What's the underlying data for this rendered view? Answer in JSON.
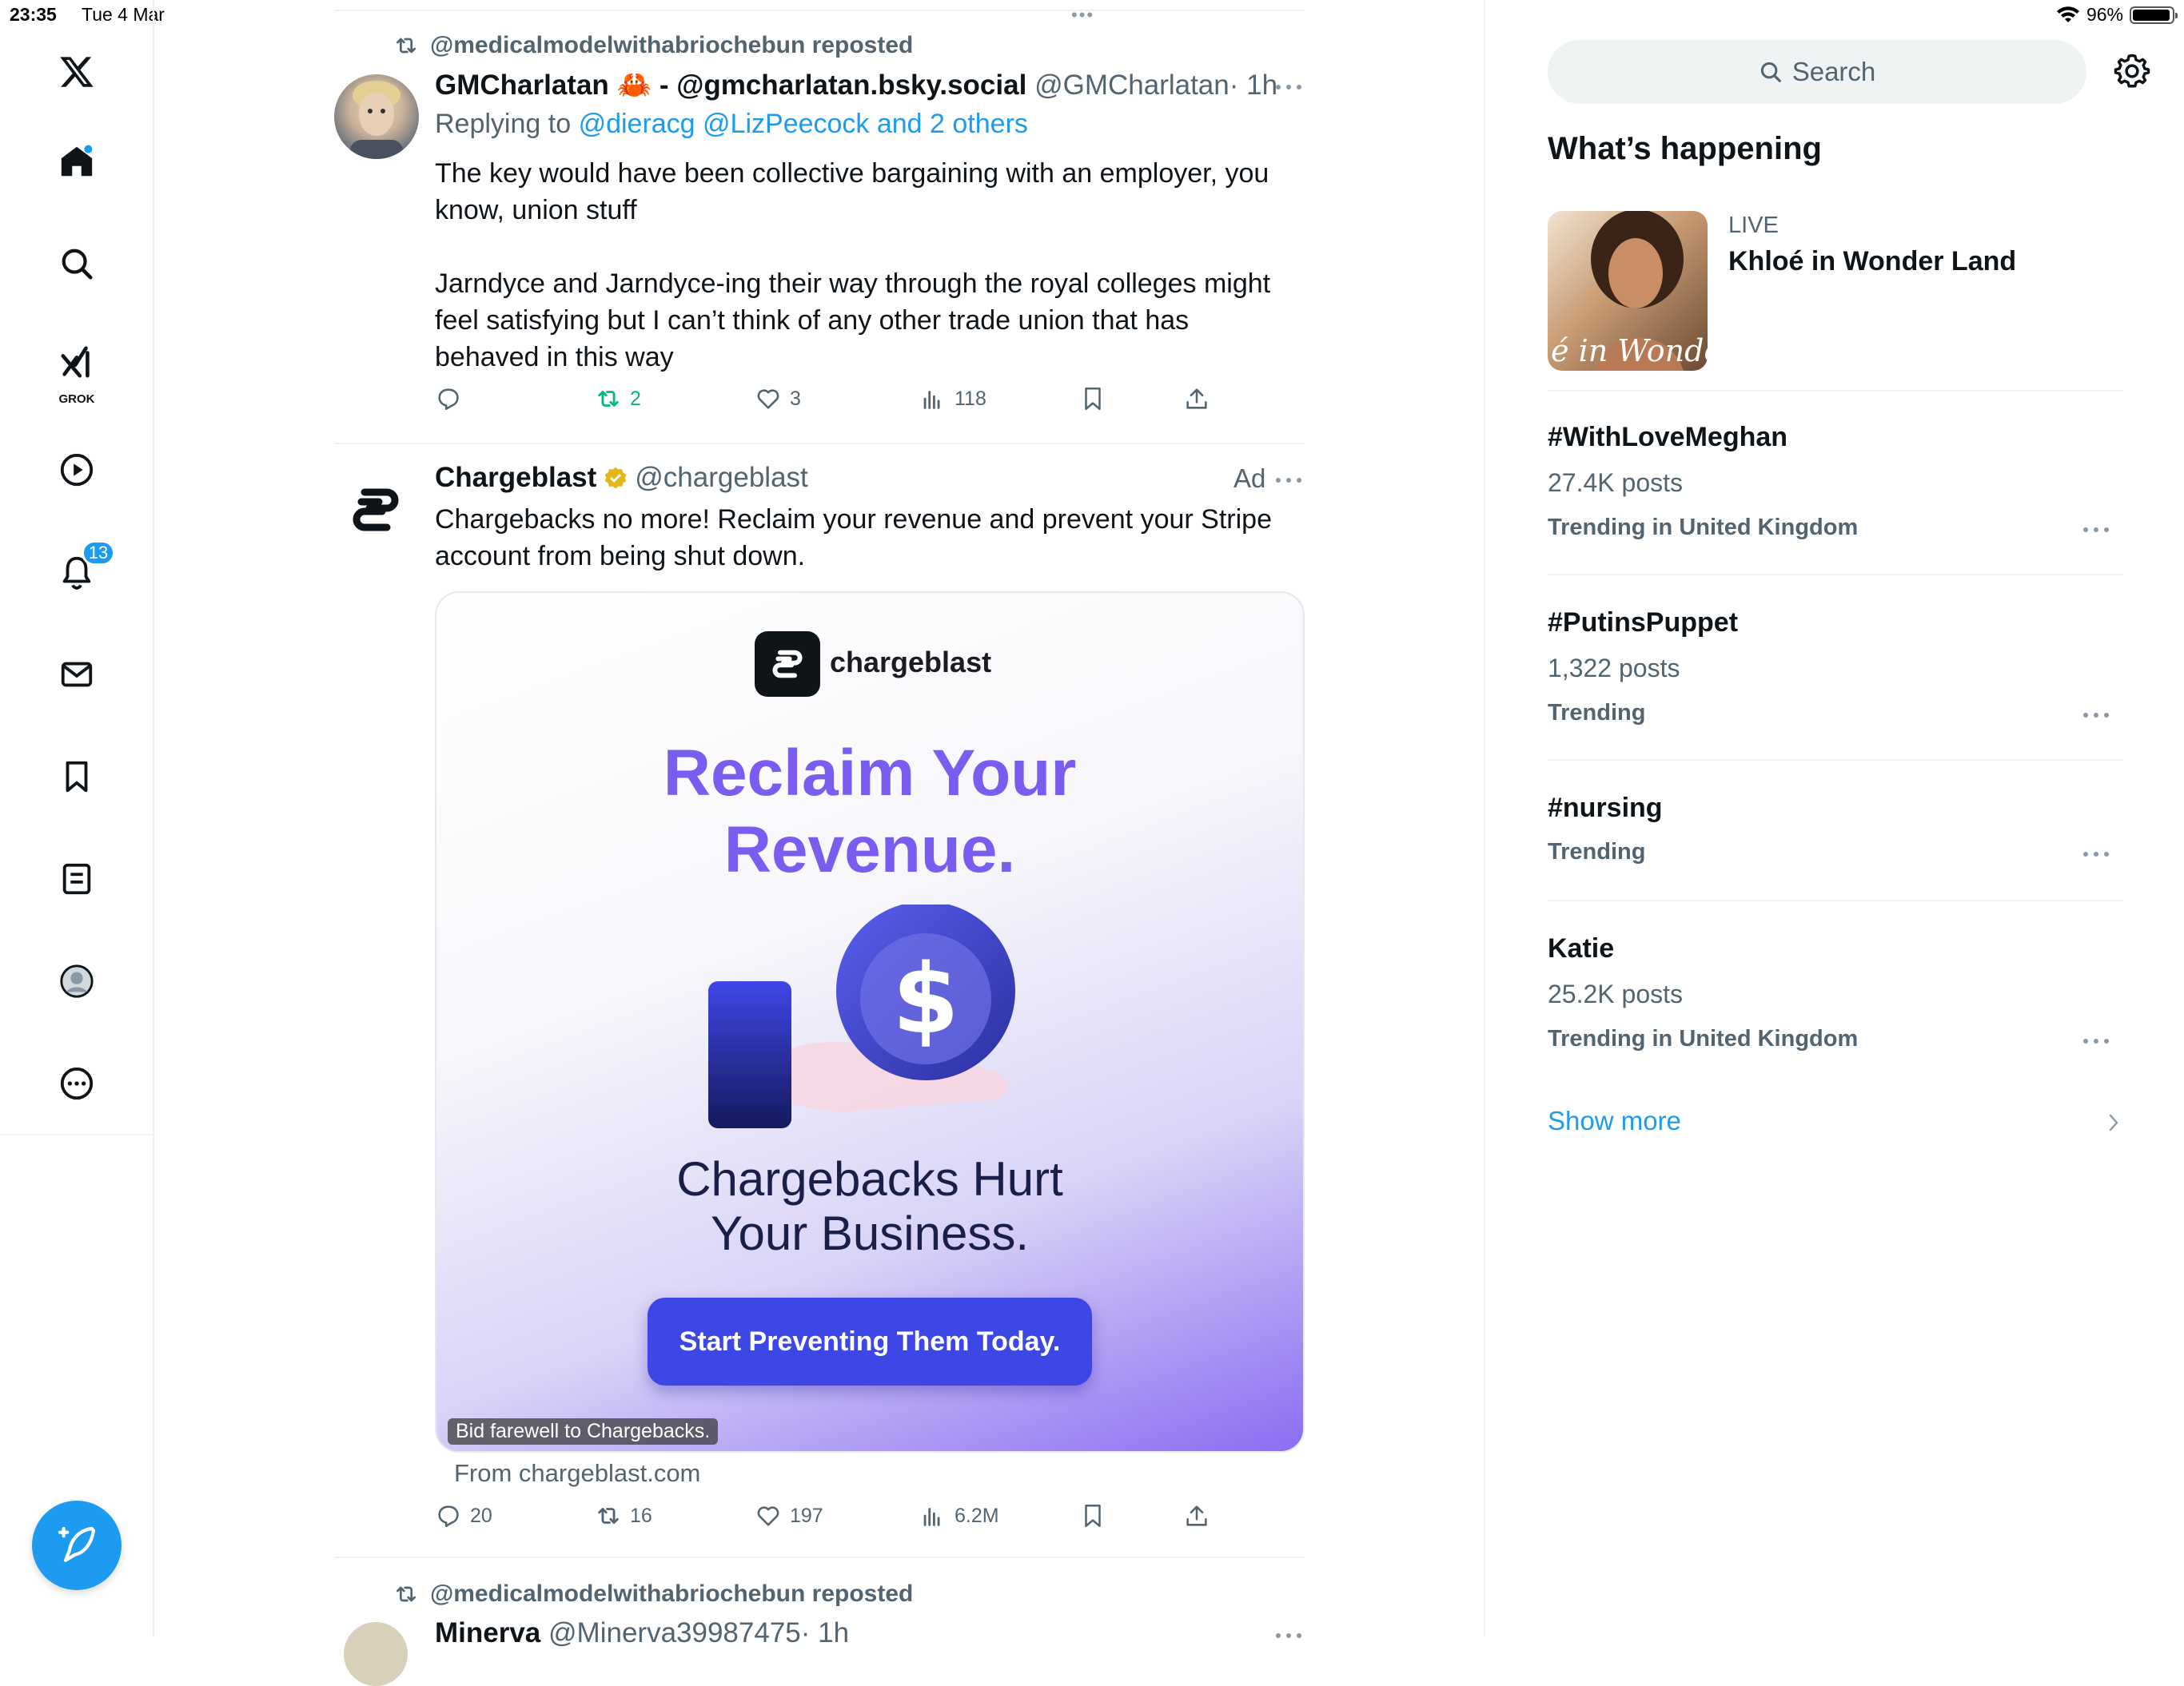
{
  "status_bar": {
    "time": "23:35",
    "date": "Tue 4 Mar",
    "battery": "96%",
    "battery_level": 0.96
  },
  "nav": {
    "grok_label": "GROK",
    "notifications_badge": "13"
  },
  "feed": {
    "top_handle_dots": "•••",
    "post1": {
      "repost_line": "@medicalmodelwithabriochebun reposted",
      "name": "GMCharlatan 🦀 - @gmcharlatan.bsky.social",
      "handle": "@GMCharlatan",
      "time": "· 1h",
      "replying_prefix": "Replying to",
      "replying_targets": "@dieracg @LizPeecock and 2 others",
      "text": "The key would have been collective bargaining with an employer, you\nknow, union stuff\n\nJarndyce and Jarndyce-ing their way through the royal colleges might\nfeel satisfying but I can’t think of any other trade union that has\nbehaved in this way",
      "reposts": "2",
      "likes": "3",
      "views": "118"
    },
    "post2": {
      "name": "Chargeblast",
      "handle": "@chargeblast",
      "ad_label": "Ad",
      "text": "Chargebacks no more! Reclaim your revenue and prevent your Stripe\naccount from being shut down.",
      "card": {
        "brand": "chargeblast",
        "headline": "Reclaim Your\nRevenue.",
        "subheadline": "Chargebacks Hurt\nYour Business.",
        "cta": "Start Preventing Them Today.",
        "caption": "Bid farewell to Chargebacks.",
        "currency_symbol": "$"
      },
      "source": "From chargeblast.com",
      "replies": "20",
      "reposts": "16",
      "likes": "197",
      "views": "6.2M"
    },
    "post3": {
      "repost_line": "@medicalmodelwithabriochebun reposted",
      "name": "Minerva",
      "handle": "@Minerva39987475",
      "time": "· 1h"
    }
  },
  "sidebar": {
    "search_placeholder": "Search",
    "heading": "What’s happening",
    "live": {
      "label": "LIVE",
      "title": "Khloé in Wonder Land",
      "image_text": "é in Wonder L"
    },
    "trends": [
      {
        "title": "#WithLoveMeghan",
        "posts": "27.4K posts",
        "context": "Trending in United Kingdom"
      },
      {
        "title": "#PutinsPuppet",
        "posts": "1,322 posts",
        "context": "Trending"
      },
      {
        "title": "#nursing",
        "posts": "",
        "context": "Trending"
      },
      {
        "title": "Katie",
        "posts": "25.2K posts",
        "context": "Trending in United Kingdom"
      }
    ],
    "show_more": "Show more"
  },
  "colors": {
    "accent": "#1d9bf0",
    "repost_green": "#00ba7c",
    "ad_purple": "#7a5cf0",
    "cta_blue": "#3d47e6"
  },
  "icons": [
    "x-logo-icon",
    "home-icon",
    "search-icon",
    "grok-icon",
    "video-icon",
    "bell-icon",
    "mail-icon",
    "bookmark-icon",
    "lists-icon",
    "profile-icon",
    "more-icon",
    "compose-icon",
    "reply-icon",
    "repost-icon",
    "like-icon",
    "views-icon",
    "share-icon",
    "settings-icon",
    "verified-icon",
    "chevron-right-icon"
  ]
}
